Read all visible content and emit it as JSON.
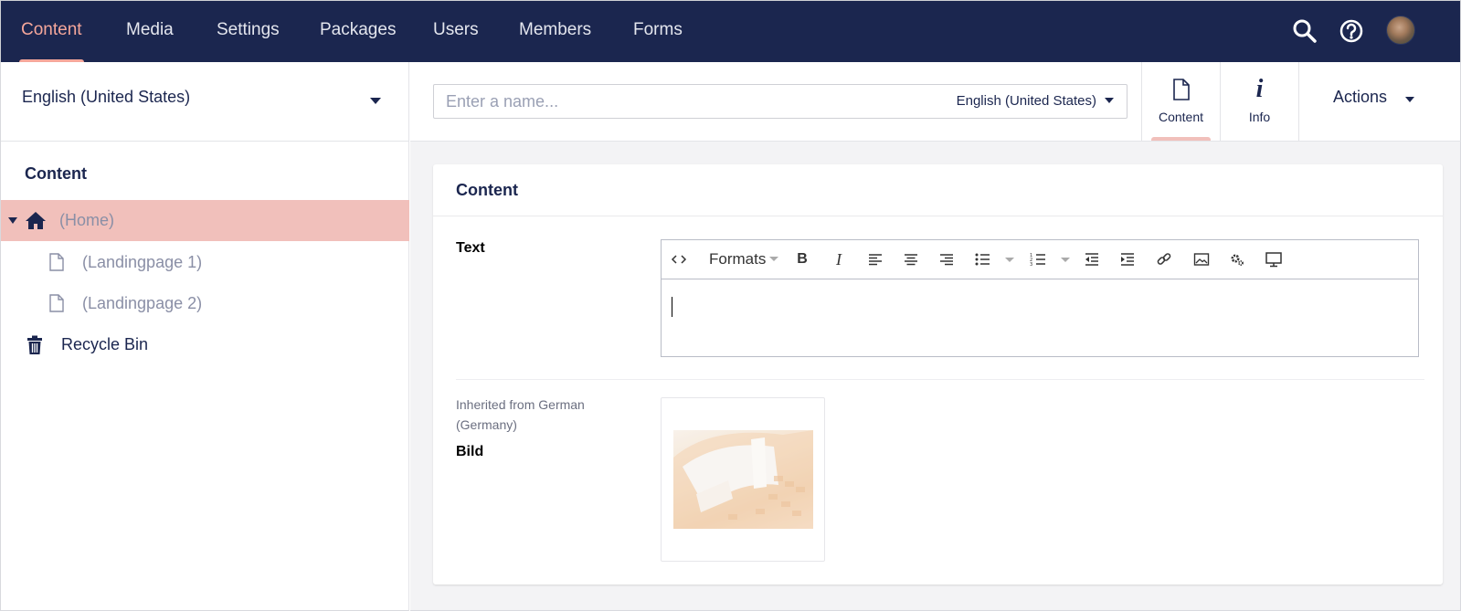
{
  "topnav": {
    "sections": [
      {
        "label": "Content",
        "active": true
      },
      {
        "label": "Media"
      },
      {
        "label": "Settings"
      },
      {
        "label": "Packages"
      },
      {
        "label": "Users"
      },
      {
        "label": "Members"
      },
      {
        "label": "Forms"
      }
    ],
    "tools": [
      "search-icon",
      "help-icon",
      "user-avatar"
    ]
  },
  "sidebar": {
    "language": "English (United States)",
    "tree_title": "Content",
    "tree": [
      {
        "label": "(Home)",
        "icon": "home-icon",
        "selected": true
      },
      {
        "label": "(Landingpage 1)",
        "icon": "document-icon"
      },
      {
        "label": "(Landingpage 2)",
        "icon": "document-icon"
      },
      {
        "label": "Recycle Bin",
        "icon": "trash-icon"
      }
    ]
  },
  "editor": {
    "name_placeholder": "Enter a name...",
    "name_value": "",
    "language": "English (United States)",
    "apps": [
      {
        "label": "Content",
        "icon": "document-icon",
        "active": true
      },
      {
        "label": "Info",
        "icon": "info-icon"
      }
    ],
    "actions_label": "Actions"
  },
  "panel": {
    "title": "Content",
    "properties": [
      {
        "label": "Text",
        "type": "rich-text"
      },
      {
        "label": "Bild",
        "description": "Inherited from German (Germany)",
        "type": "image"
      }
    ],
    "rte": {
      "formats_label": "Formats",
      "buttons": [
        "source-code-icon",
        "bold-icon",
        "italic-icon",
        "align-left-icon",
        "align-center-icon",
        "align-right-icon",
        "bullet-list-icon",
        "numbered-list-icon",
        "outdent-icon",
        "indent-icon",
        "link-icon",
        "image-icon",
        "macro-icon",
        "embed-icon"
      ]
    }
  },
  "colors": {
    "header_bg": "#1b264f",
    "accent": "#f5a79b",
    "selected_bg": "#f1c0bb"
  }
}
